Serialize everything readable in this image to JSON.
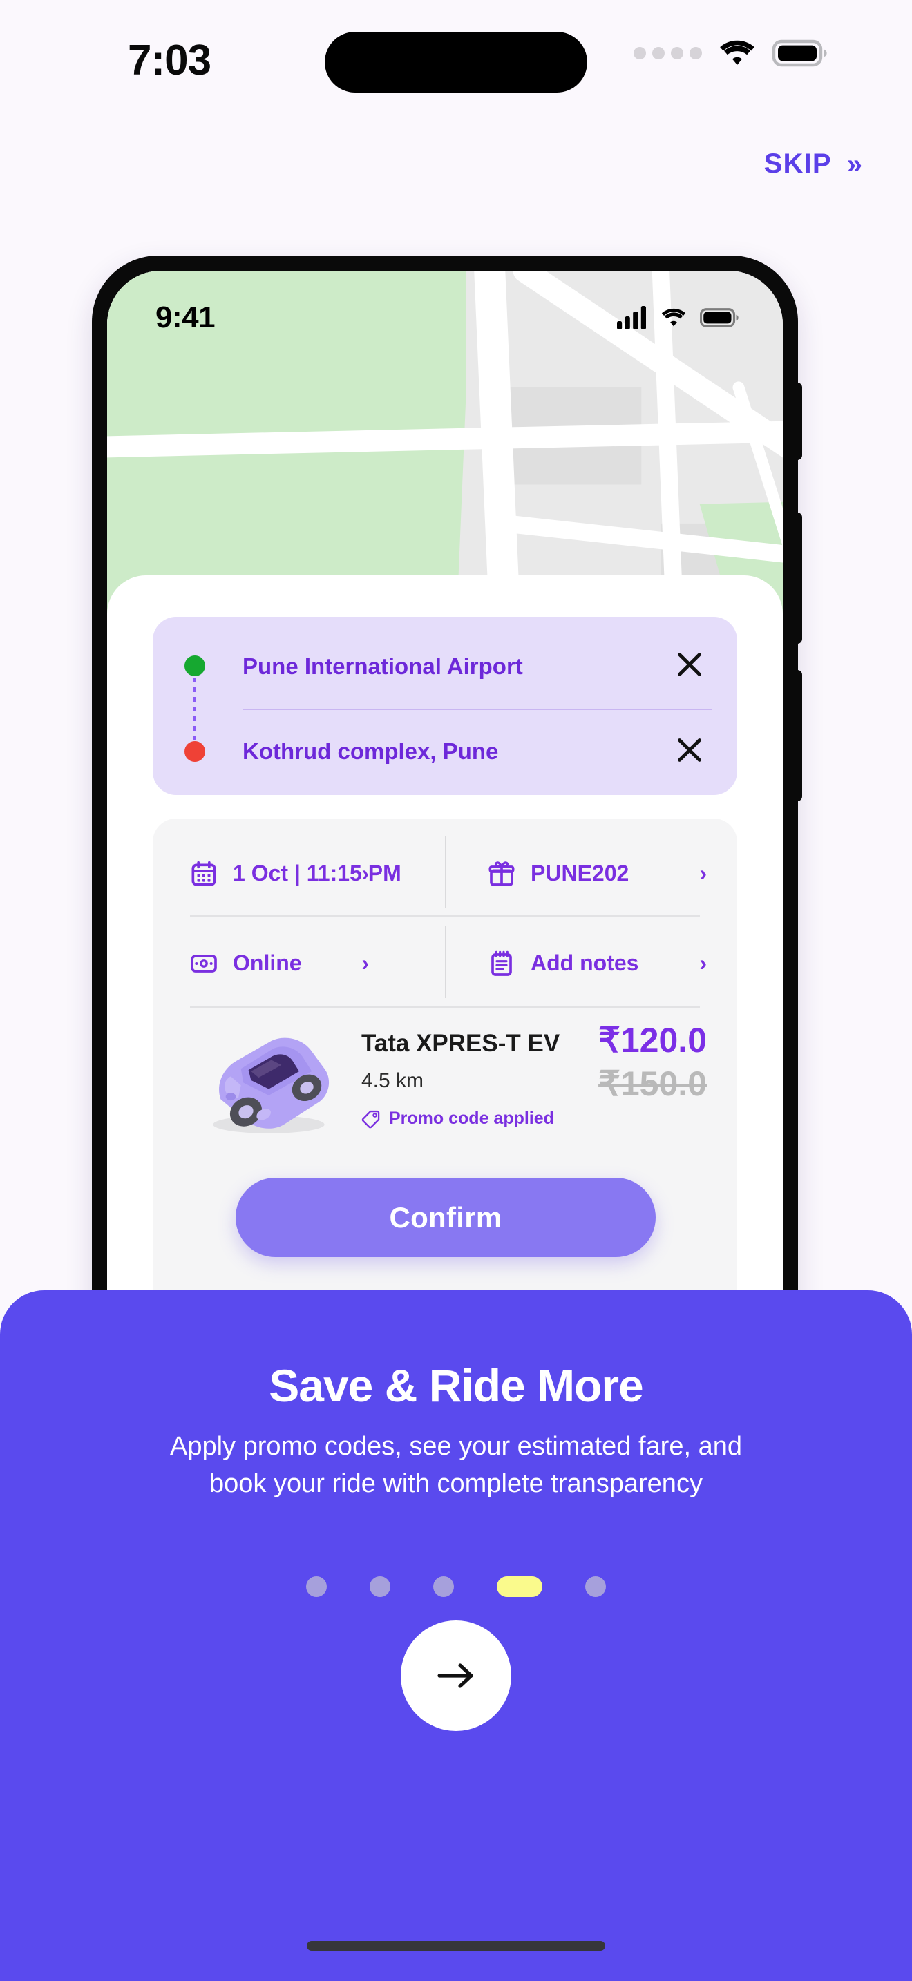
{
  "theme": {
    "page_bg": "#FBF8FD",
    "brand_purple": "#5A4AEE",
    "accent_purple": "#7A2FE0",
    "confirm_purple": "#8878F2",
    "card_lavender": "#E5DDFA",
    "active_dot_yellow": "#FAFA8C",
    "inactive_dot": "#A6A0DC",
    "green_marker": "#16A830",
    "red_marker": "#EF4136",
    "old_price_gray": "#B9B9B9"
  },
  "outer_status_bar": {
    "time": "7:03",
    "icons": [
      "signal-dots-icon",
      "wifi-icon",
      "battery-icon"
    ]
  },
  "skip": {
    "label": "SKIP",
    "chevron": "»",
    "icon_name": "double-chevron-right-icon"
  },
  "phone_preview": {
    "status_bar": {
      "time": "9:41",
      "icons": [
        "cellular-bars-icon",
        "wifi-icon",
        "battery-icon"
      ]
    },
    "map": {
      "pickup_marker": "green-dot-marker",
      "dropoff_marker": "red-dot-marker"
    },
    "location_card": {
      "pickup": {
        "label": "Pune International Airport",
        "dot_color": "#16A830",
        "clear_icon": "close-icon"
      },
      "dropoff": {
        "label": "Kothrud complex, Pune",
        "dot_color": "#EF4136",
        "clear_icon": "close-icon"
      }
    },
    "options": [
      {
        "icon": "calendar-icon",
        "label": "1 Oct | 11:15 PM",
        "chevron": "›"
      },
      {
        "icon": "gift-icon",
        "label": "PUNE202",
        "chevron": "›"
      },
      {
        "icon": "payment-card-icon",
        "label": "Online",
        "chevron": "›"
      },
      {
        "icon": "notes-icon",
        "label": "Add notes",
        "chevron": "›"
      }
    ],
    "ride": {
      "vehicle_icon": "car-icon",
      "vehicle_name": "Tata XPRES-T EV",
      "distance": "4.5 km",
      "promo_icon": "tag-icon",
      "promo_text": "Promo code applied",
      "price_current": "₹120.0",
      "price_original": "₹150.0"
    },
    "confirm_label": "Confirm"
  },
  "onboarding": {
    "headline": "Save & Ride More",
    "subtext": "Apply promo codes, see your estimated fare, and book your ride with complete transparency",
    "pagination": {
      "total": 5,
      "active_index": 3
    },
    "next_icon": "arrow-right-icon"
  }
}
